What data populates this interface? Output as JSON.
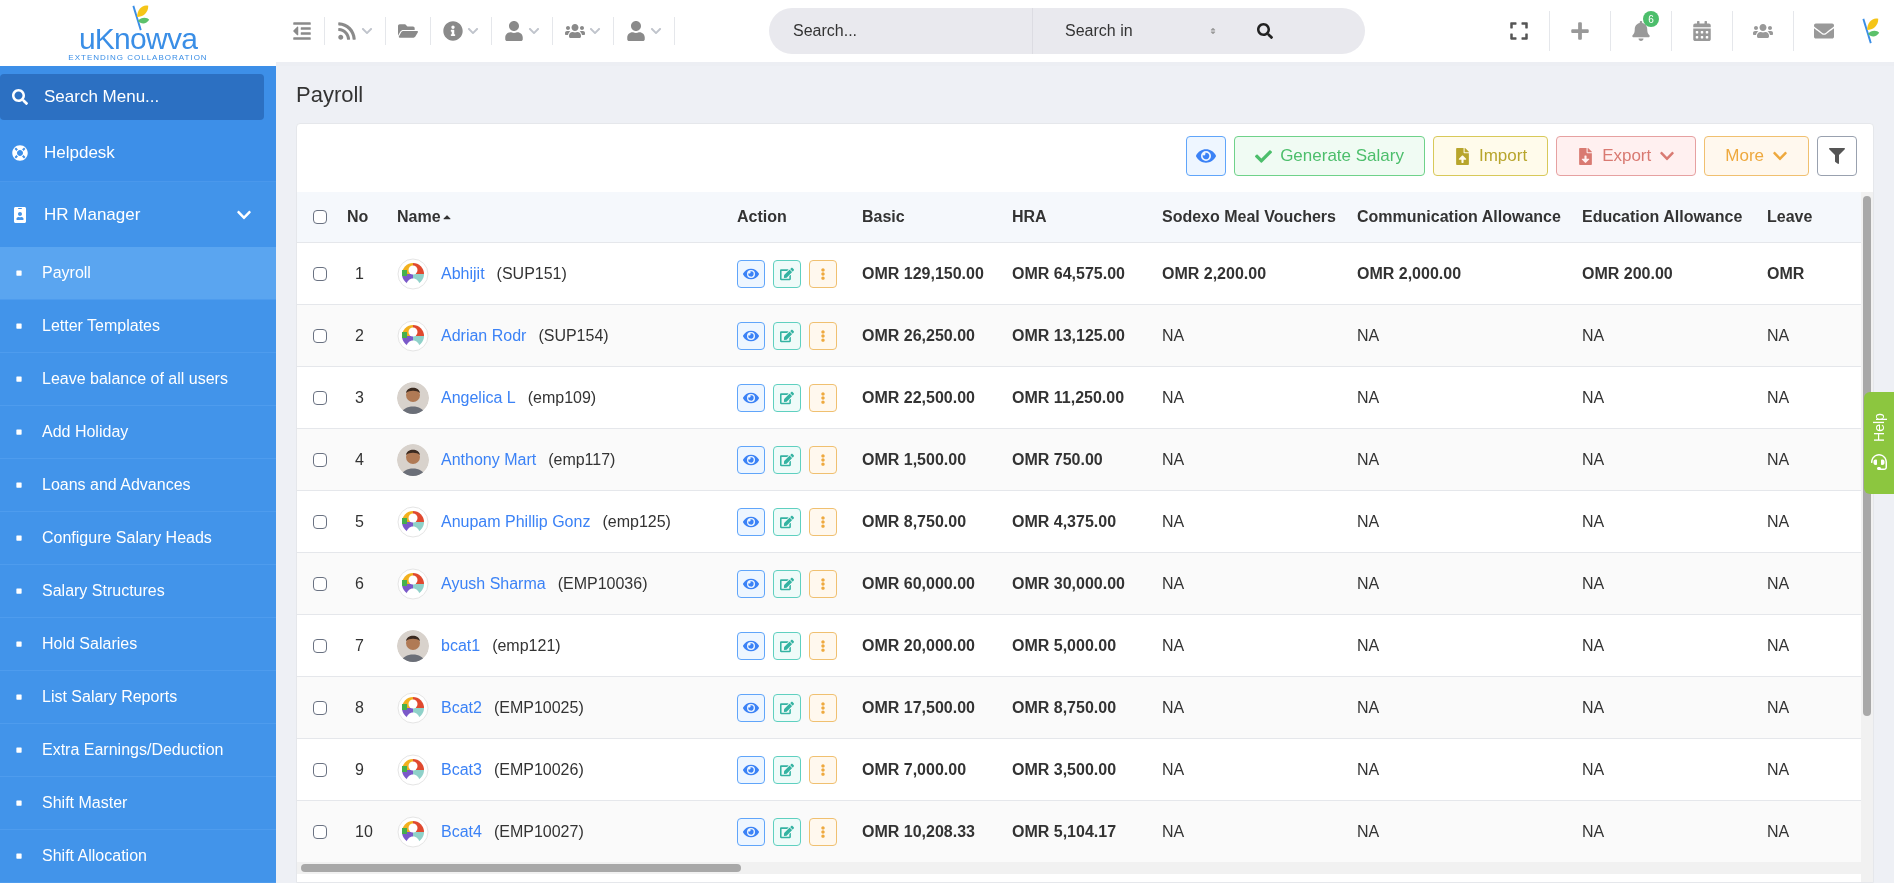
{
  "logo": {
    "name": "uKnowva",
    "tagline": "EXTENDING COLLABORATION"
  },
  "sidebar": {
    "search": {
      "placeholder": "Search Menu..."
    },
    "items": [
      {
        "label": "Helpdesk",
        "kind": "link"
      },
      {
        "label": "HR Manager",
        "kind": "group",
        "expanded": true,
        "children": [
          {
            "label": "Payroll",
            "selected": true
          },
          {
            "label": "Letter Templates",
            "selected": false
          },
          {
            "label": "Leave balance of all users",
            "selected": false
          },
          {
            "label": "Add Holiday",
            "selected": false
          },
          {
            "label": "Loans and Advances",
            "selected": false
          },
          {
            "label": "Configure Salary Heads",
            "selected": false
          },
          {
            "label": "Salary Structures",
            "selected": false
          },
          {
            "label": "Hold Salaries",
            "selected": false
          },
          {
            "label": "List Salary Reports",
            "selected": false
          },
          {
            "label": "Extra Earnings/Deduction",
            "selected": false
          },
          {
            "label": "Shift Master",
            "selected": false
          },
          {
            "label": "Shift Allocation",
            "selected": false
          }
        ]
      }
    ]
  },
  "topbar": {
    "search": {
      "placeholder": "Search...",
      "scope": "Search in"
    },
    "notifications": "6"
  },
  "page_title": "Payroll",
  "toolbar": [
    {
      "kind": "view"
    },
    {
      "kind": "generate",
      "label": "Generate Salary"
    },
    {
      "kind": "import",
      "label": "Import"
    },
    {
      "kind": "export",
      "label": "Export"
    },
    {
      "kind": "more",
      "label": "More"
    },
    {
      "kind": "filter"
    }
  ],
  "help_tab": "Help",
  "table": {
    "all_checked": false,
    "columns": [
      "No",
      "Name",
      "Action",
      "Basic",
      "HRA",
      "Sodexo Meal Vouchers",
      "Communication Allowance",
      "Education Allowance",
      "Leave"
    ],
    "rows": [
      {
        "checked": false,
        "no": "1",
        "name": "Abhijit",
        "code": "(SUP151)",
        "avatar": {
          "kind": "generic"
        },
        "basic": "OMR 129,150.00",
        "hra": "OMR 64,575.00",
        "extras": [
          {
            "kind": "amount",
            "text": "OMR 2,200.00"
          },
          {
            "kind": "amount",
            "text": "OMR 2,000.00"
          },
          {
            "kind": "amount",
            "text": "OMR 200.00"
          },
          {
            "kind": "amount",
            "text": "OMR"
          }
        ]
      },
      {
        "checked": false,
        "no": "2",
        "name": "Adrian Rodr",
        "code": "(SUP154)",
        "avatar": {
          "kind": "generic"
        },
        "basic": "OMR 26,250.00",
        "hra": "OMR 13,125.00",
        "extras": [
          {
            "kind": "na",
            "text": "NA"
          },
          {
            "kind": "na",
            "text": "NA"
          },
          {
            "kind": "na",
            "text": "NA"
          },
          {
            "kind": "na",
            "text": "NA"
          }
        ]
      },
      {
        "checked": false,
        "no": "3",
        "name": "Angelica L",
        "code": "(emp109)",
        "basic": "OMR 22,500.00",
        "hra": "OMR 11,250.00",
        "extras": [
          {
            "kind": "na",
            "text": "NA"
          },
          {
            "kind": "na",
            "text": "NA"
          },
          {
            "kind": "na",
            "text": "NA"
          },
          {
            "kind": "na",
            "text": "NA"
          }
        ]
      },
      {
        "checked": false,
        "no": "4",
        "name": "Anthony Mart",
        "code": "(emp117)",
        "basic": "OMR 1,500.00",
        "hra": "OMR 750.00",
        "extras": [
          {
            "kind": "na",
            "text": "NA"
          },
          {
            "kind": "na",
            "text": "NA"
          },
          {
            "kind": "na",
            "text": "NA"
          },
          {
            "kind": "na",
            "text": "NA"
          }
        ]
      },
      {
        "checked": false,
        "no": "5",
        "name": "Anupam Phillip Gonz",
        "code": "(emp125)",
        "avatar": {
          "kind": "generic"
        },
        "basic": "OMR 8,750.00",
        "hra": "OMR 4,375.00",
        "extras": [
          {
            "kind": "na",
            "text": "NA"
          },
          {
            "kind": "na",
            "text": "NA"
          },
          {
            "kind": "na",
            "text": "NA"
          },
          {
            "kind": "na",
            "text": "NA"
          }
        ]
      },
      {
        "checked": false,
        "no": "6",
        "name": "Ayush Sharma",
        "code": "(EMP10036)",
        "avatar": {
          "kind": "generic"
        },
        "basic": "OMR 60,000.00",
        "hra": "OMR 30,000.00",
        "extras": [
          {
            "kind": "na",
            "text": "NA"
          },
          {
            "kind": "na",
            "text": "NA"
          },
          {
            "kind": "na",
            "text": "NA"
          },
          {
            "kind": "na",
            "text": "NA"
          }
        ]
      },
      {
        "checked": false,
        "no": "7",
        "name": "bcat1",
        "code": "(emp121)",
        "basic": "OMR 20,000.00",
        "hra": "OMR 5,000.00",
        "extras": [
          {
            "kind": "na",
            "text": "NA"
          },
          {
            "kind": "na",
            "text": "NA"
          },
          {
            "kind": "na",
            "text": "NA"
          },
          {
            "kind": "na",
            "text": "NA"
          }
        ]
      },
      {
        "checked": false,
        "no": "8",
        "name": "Bcat2",
        "code": "(EMP10025)",
        "avatar": {
          "kind": "generic"
        },
        "basic": "OMR 17,500.00",
        "hra": "OMR 8,750.00",
        "extras": [
          {
            "kind": "na",
            "text": "NA"
          },
          {
            "kind": "na",
            "text": "NA"
          },
          {
            "kind": "na",
            "text": "NA"
          },
          {
            "kind": "na",
            "text": "NA"
          }
        ]
      },
      {
        "checked": false,
        "no": "9",
        "name": "Bcat3",
        "code": "(EMP10026)",
        "avatar": {
          "kind": "generic"
        },
        "basic": "OMR 7,000.00",
        "hra": "OMR 3,500.00",
        "extras": [
          {
            "kind": "na",
            "text": "NA"
          },
          {
            "kind": "na",
            "text": "NA"
          },
          {
            "kind": "na",
            "text": "NA"
          },
          {
            "kind": "na",
            "text": "NA"
          }
        ]
      },
      {
        "checked": false,
        "no": "10",
        "name": "Bcat4",
        "code": "(EMP10027)",
        "avatar": {
          "kind": "generic"
        },
        "basic": "OMR 10,208.33",
        "hra": "OMR 5,104.17",
        "extras": [
          {
            "kind": "na",
            "text": "NA"
          },
          {
            "kind": "na",
            "text": "NA"
          },
          {
            "kind": "na",
            "text": "NA"
          },
          {
            "kind": "na",
            "text": "NA"
          }
        ]
      }
    ]
  }
}
